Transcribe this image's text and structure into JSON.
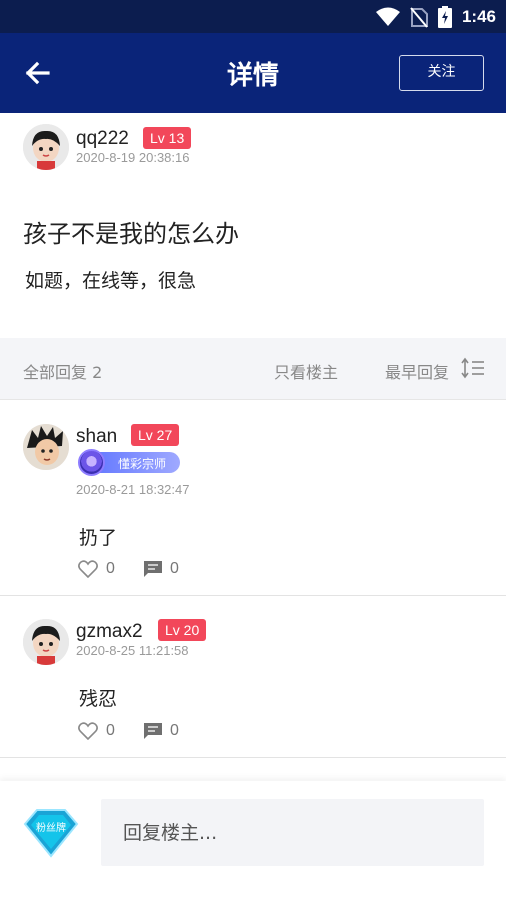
{
  "status_bar": {
    "time": "1:46",
    "icons": [
      "wifi-icon",
      "no-sim-icon",
      "battery-icon"
    ]
  },
  "header": {
    "title": "详情",
    "follow_label": "关注",
    "back_icon": "arrow-left-icon"
  },
  "post": {
    "author": "qq222",
    "level": "Lv 13",
    "timestamp": "2020-8-19 20:38:16",
    "title": "孩子不是我的怎么办",
    "body": "如题，在线等，很急"
  },
  "filter": {
    "all_replies": "全部回复 2",
    "only_owner": "只看楼主",
    "earliest": "最早回复",
    "sort_icon": "sort-order-icon"
  },
  "replies": [
    {
      "author": "shan",
      "level": "Lv 27",
      "medal": "懂彩宗师",
      "timestamp": "2020-8-21 18:32:47",
      "text": "扔了",
      "likes": "0",
      "comments": "0"
    },
    {
      "author": "gzmax2",
      "level": "Lv 20",
      "timestamp": "2020-8-25 11:21:58",
      "text": "残忍",
      "likes": "0",
      "comments": "0"
    }
  ],
  "bottom": {
    "fan_badge": "粉丝牌",
    "reply_placeholder": "回复楼主..."
  },
  "colors": {
    "header_bg": "#0a2479",
    "status_bg": "#0c1d4f",
    "level_badge": "#f2475a",
    "medal_badge": "#5b71ff"
  }
}
